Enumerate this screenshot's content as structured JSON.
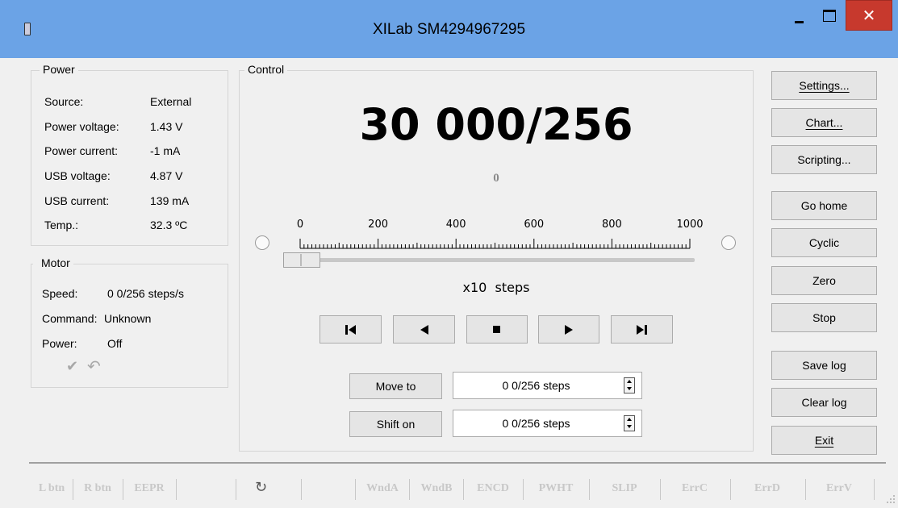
{
  "window": {
    "title": "XILab SM4294967295"
  },
  "titlebar": {
    "close_glyph": "✕"
  },
  "power": {
    "legend": "Power",
    "rows": [
      {
        "label": "Source:",
        "value": "External"
      },
      {
        "label": "Power voltage:",
        "value": "1.43 V"
      },
      {
        "label": "Power current:",
        "value": "-1 mA"
      },
      {
        "label": "USB voltage:",
        "value": "4.87 V"
      },
      {
        "label": "USB current:",
        "value": "139 mA"
      },
      {
        "label": "Temp.:",
        "value": "32.3 ºC"
      }
    ]
  },
  "motor": {
    "legend": "Motor",
    "speed_label": "Speed:",
    "speed_value": "0 0/256 steps/s",
    "command_label": "Command:",
    "command_value": "Unknown",
    "power_label": "Power:",
    "power_value": "Off",
    "check_icon": "✔",
    "undo_icon": "↶"
  },
  "control": {
    "legend": "Control",
    "position": "30 000/256",
    "encoder": "0",
    "scale_labels": [
      "0",
      "200",
      "400",
      "600",
      "800",
      "1000"
    ],
    "slider_fraction": 0,
    "units": "x10  steps",
    "move_to_label": "Move to",
    "move_to_value": "0 0/256 steps",
    "shift_on_label": "Shift on",
    "shift_on_value": "0 0/256 steps",
    "nav_icons": [
      "go-to-left-end-icon",
      "move-left-icon",
      "stop-icon",
      "move-right-icon",
      "go-to-right-end-icon"
    ]
  },
  "side_buttons": [
    {
      "name": "settings-button",
      "label": "Settings..."
    },
    {
      "name": "chart-button",
      "label": "Chart..."
    },
    {
      "name": "scripting-button",
      "label": "Scripting..."
    },
    {
      "name": "go-home-button",
      "label": "Go home"
    },
    {
      "name": "cyclic-button",
      "label": "Cyclic"
    },
    {
      "name": "zero-button",
      "label": "Zero"
    },
    {
      "name": "stop-button",
      "label": "Stop"
    },
    {
      "name": "save-log-button",
      "label": "Save log"
    },
    {
      "name": "clear-log-button",
      "label": "Clear log"
    },
    {
      "name": "exit-button",
      "label": "Exit"
    }
  ],
  "status": {
    "items": [
      "L btn",
      "R btn",
      "EEPR",
      "WndA",
      "WndB",
      "ENCD",
      "PWHT",
      "SLIP",
      "ErrC",
      "ErrD",
      "ErrV"
    ],
    "refresh_icon": "↻",
    "color_inactive": "#c8c8c8"
  },
  "colors": {
    "titlebar": "#6ba3e6",
    "close": "#c7392d",
    "window_bg": "#f0f0f0"
  }
}
